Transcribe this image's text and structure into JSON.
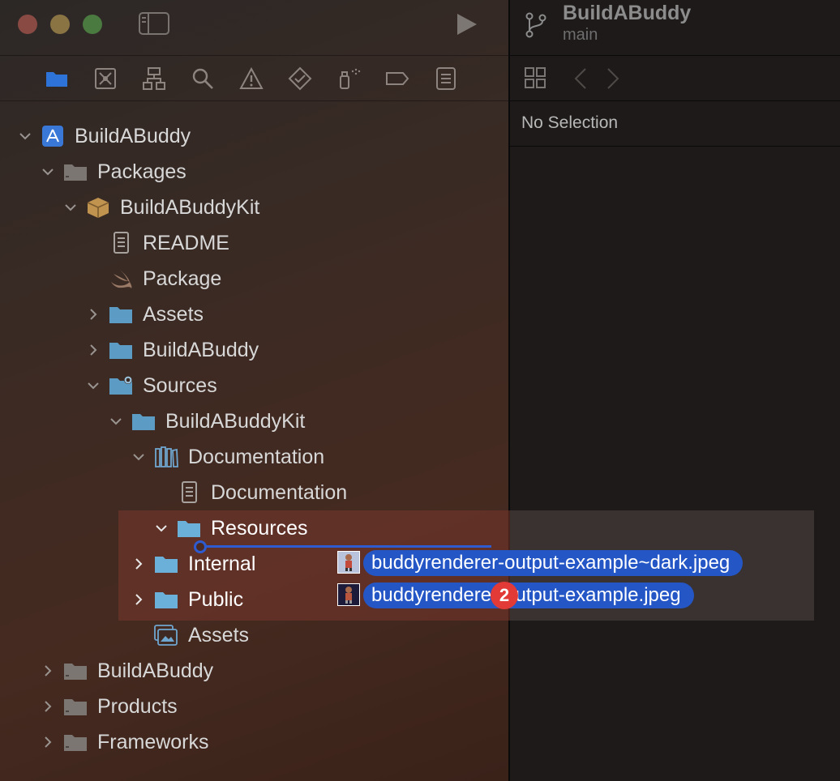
{
  "project": {
    "title": "BuildABuddy",
    "branch": "main"
  },
  "inspector": {
    "empty_text": "No Selection"
  },
  "navigator_tabs": [
    {
      "name": "project-navigator",
      "active": true
    },
    {
      "name": "source-control-navigator"
    },
    {
      "name": "symbol-navigator"
    },
    {
      "name": "find-navigator"
    },
    {
      "name": "issue-navigator"
    },
    {
      "name": "test-navigator"
    },
    {
      "name": "debug-navigator"
    },
    {
      "name": "breakpoint-navigator"
    },
    {
      "name": "report-navigator"
    }
  ],
  "tree": {
    "root": "BuildABuddy",
    "packages": "Packages",
    "kit": "BuildABuddyKit",
    "readme": "README",
    "package": "Package",
    "assets": "Assets",
    "buildabuddy": "BuildABuddy",
    "sources": "Sources",
    "sources_kit": "BuildABuddyKit",
    "documentation_catalog": "Documentation",
    "documentation_file": "Documentation",
    "resources": "Resources",
    "internal": "Internal",
    "public": "Public",
    "doc_assets": "Assets",
    "app_group": "BuildABuddy",
    "products": "Products",
    "frameworks": "Frameworks"
  },
  "drag": {
    "items": [
      "buddyrenderer-output-example~dark.jpeg",
      "buddyrenderer-output-example.jpeg"
    ],
    "count": "2"
  },
  "colors": {
    "accent": "#2456c6",
    "badge": "#e23a36",
    "folder": "#6ab0d8"
  }
}
